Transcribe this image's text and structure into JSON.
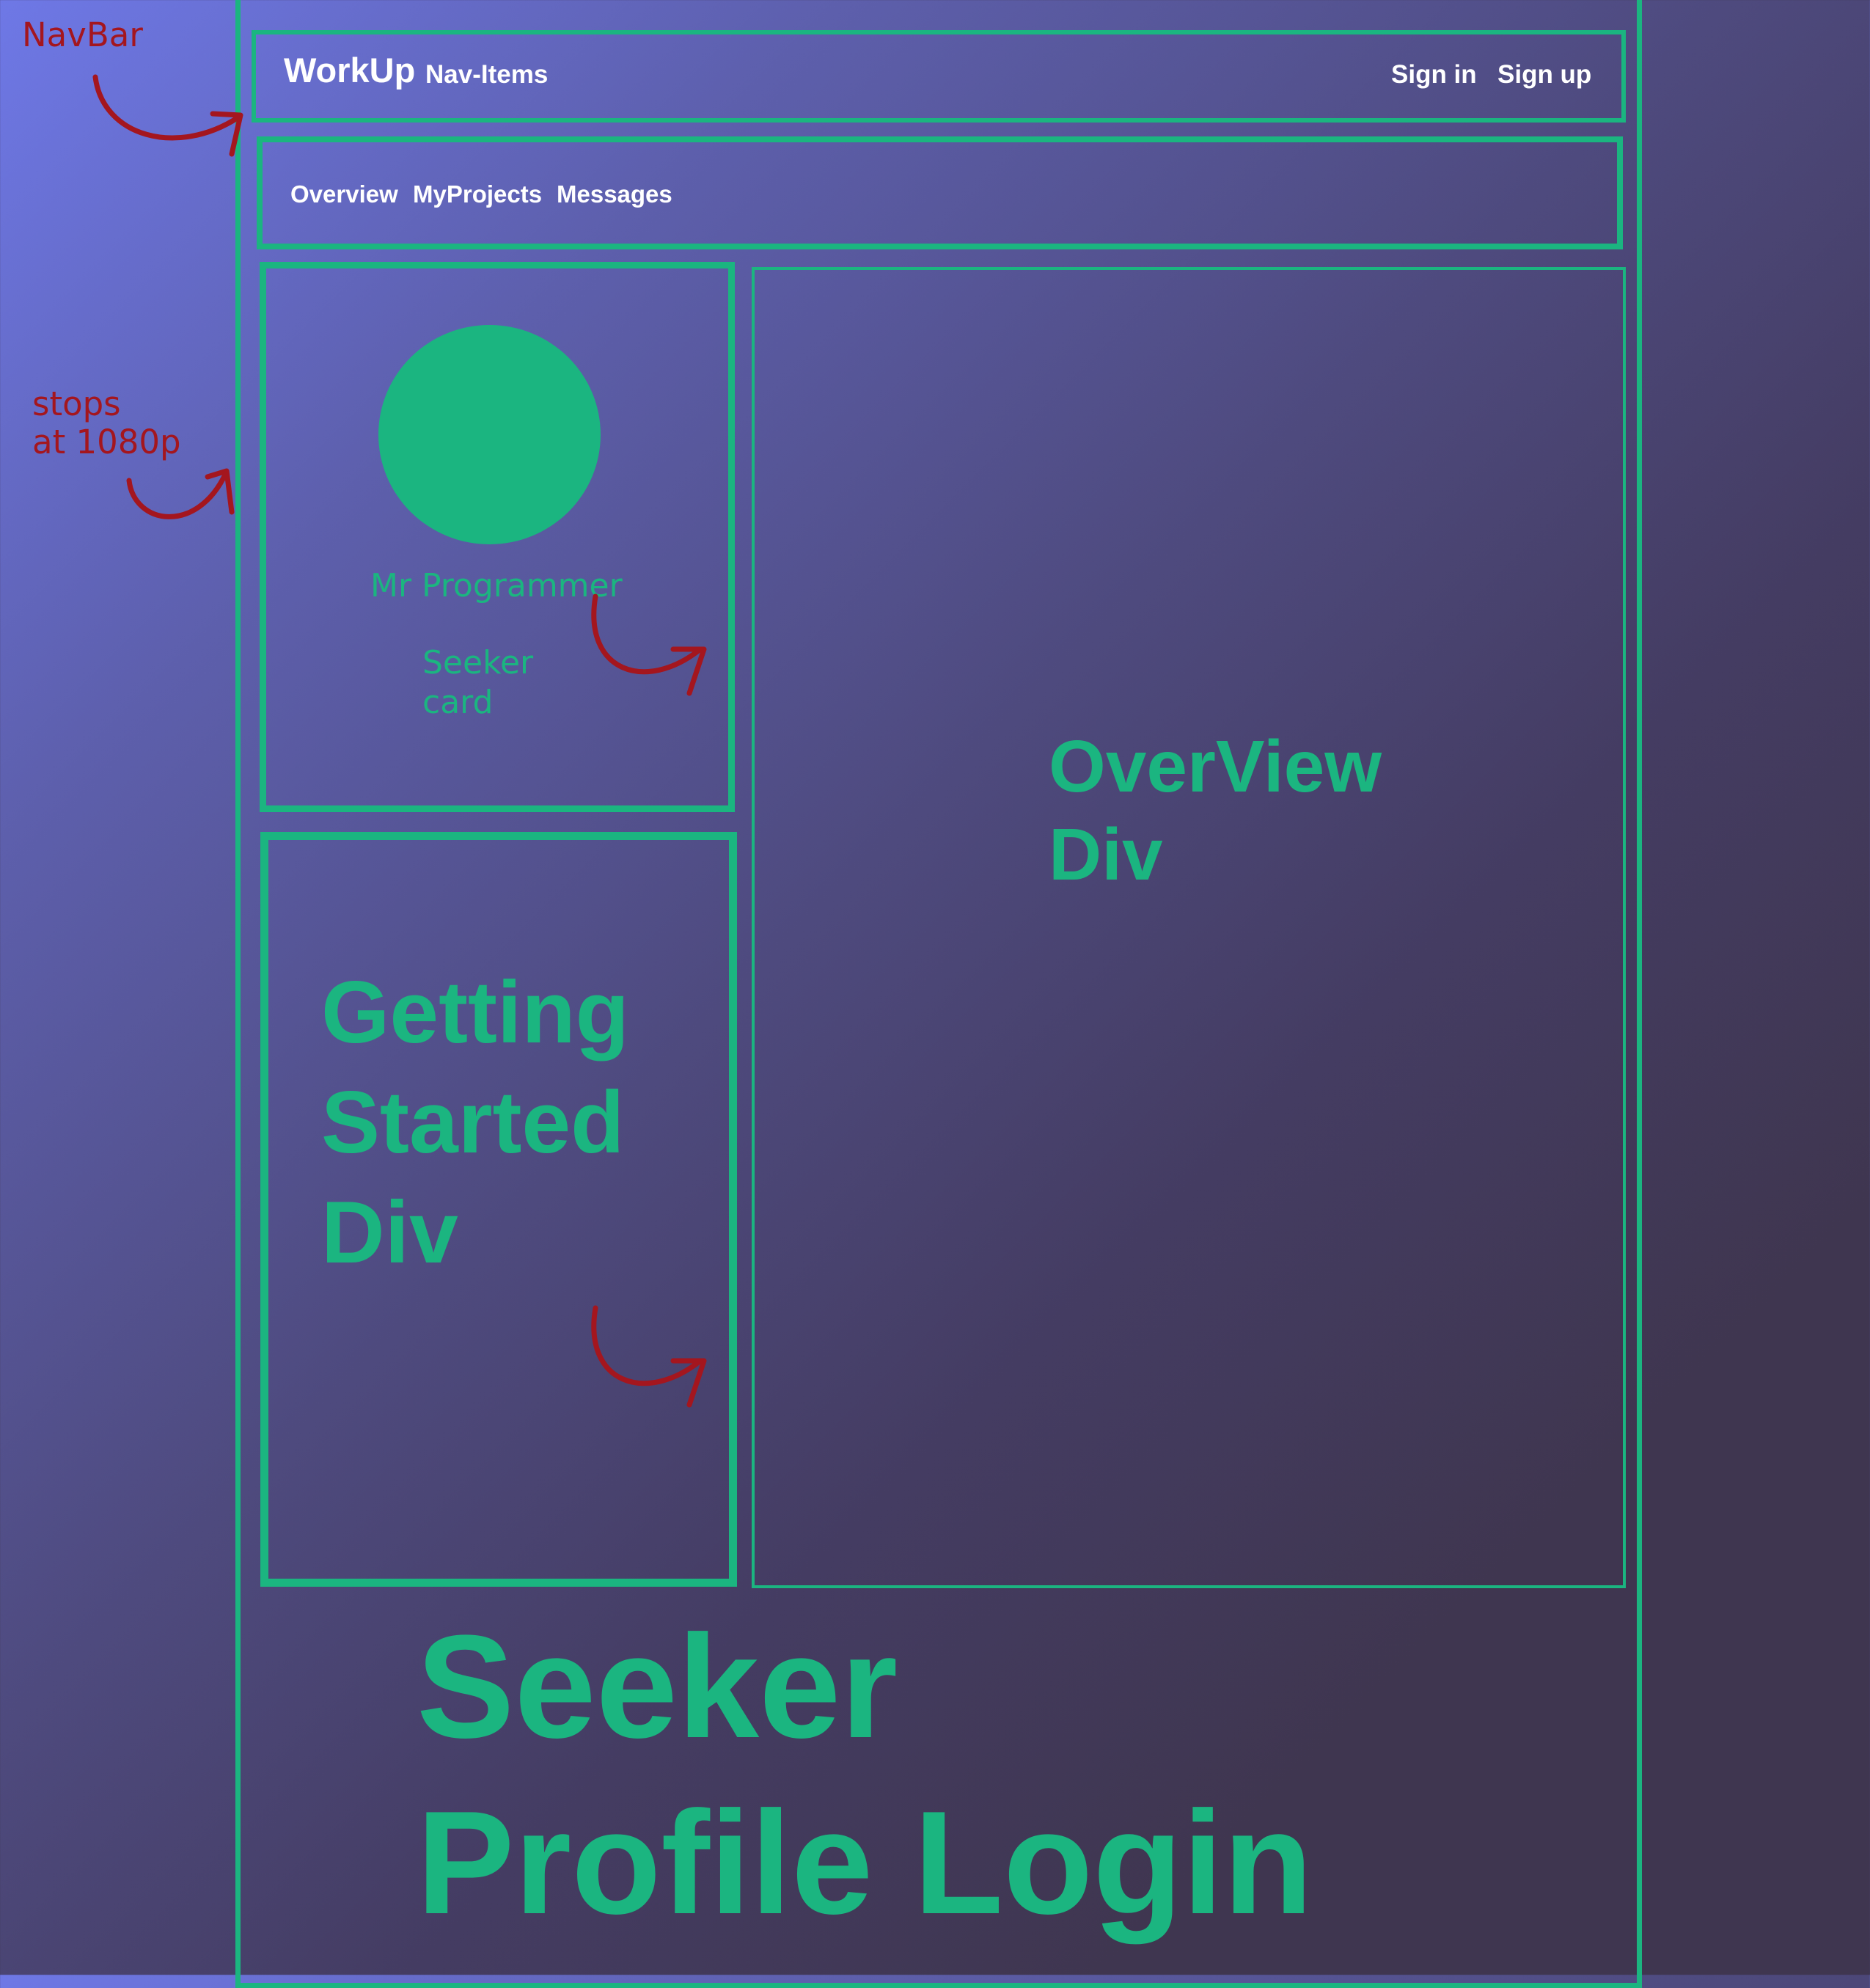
{
  "navbar": {
    "brand": "WorkUp",
    "nav_items_label": "Nav-Items",
    "sign_in_label": "Sign in",
    "sign_up_label": "Sign up"
  },
  "subnav": {
    "tabs": [
      {
        "label": "Overview"
      },
      {
        "label": "MyProjects"
      },
      {
        "label": "Messages"
      }
    ]
  },
  "seeker_card": {
    "user_name": "Mr Programmer",
    "label": "Seeker\ncard"
  },
  "getting_started": {
    "label": "Getting\nStarted\nDiv"
  },
  "overview": {
    "label": "OverView\nDiv"
  },
  "page_title": "Seeker\nProfile Login",
  "annotations": {
    "navbar": "NavBar",
    "stops": "stops\nat 1080p"
  },
  "colors": {
    "accent_green": "#1bb580",
    "annotation_red": "#a4161e",
    "text_white": "#ffffff",
    "gradient_start": "#6e78e6",
    "gradient_end": "#3f3650"
  },
  "icons": {
    "arrow": "curved-arrow-icon"
  }
}
